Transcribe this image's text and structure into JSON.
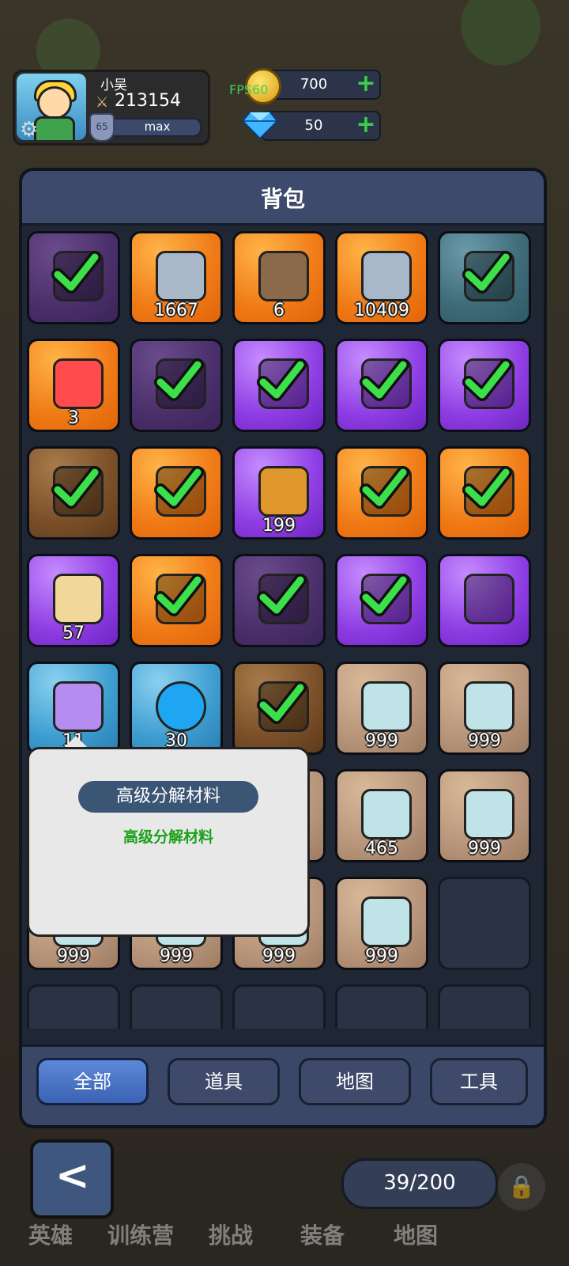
{
  "player": {
    "name": "小吴",
    "power": "213154",
    "level": "65",
    "level_status": "max"
  },
  "resources": {
    "gold": "700",
    "gems": "50",
    "fps_label": "FPS60"
  },
  "bag": {
    "title": "背包",
    "capacity": "39/200",
    "rows": [
      [
        {
          "rarity": "dpurple",
          "count": "",
          "checked": true,
          "icon": "helmet-icon"
        },
        {
          "rarity": "orange",
          "count": "1667",
          "checked": false,
          "icon": "rune-stone-icon"
        },
        {
          "rarity": "orange",
          "count": "6",
          "checked": false,
          "icon": "paw-icon"
        },
        {
          "rarity": "orange",
          "count": "10409",
          "checked": false,
          "icon": "rune-stone-icon"
        },
        {
          "rarity": "teal",
          "count": "",
          "checked": true,
          "icon": "sword-icon"
        }
      ],
      [
        {
          "rarity": "orange",
          "count": "3",
          "checked": false,
          "icon": "red-crystal-icon"
        },
        {
          "rarity": "dpurple",
          "count": "",
          "checked": true,
          "icon": "shield-icon"
        },
        {
          "rarity": "purple",
          "count": "",
          "checked": true,
          "icon": "scarf-icon"
        },
        {
          "rarity": "purple",
          "count": "",
          "checked": true,
          "icon": "ring-icon"
        },
        {
          "rarity": "purple",
          "count": "",
          "checked": true,
          "icon": "leaf-icon"
        }
      ],
      [
        {
          "rarity": "brown",
          "count": "",
          "checked": true,
          "icon": "helmet-icon"
        },
        {
          "rarity": "orange",
          "count": "",
          "checked": true,
          "icon": "gloves-icon"
        },
        {
          "rarity": "purple",
          "count": "199",
          "checked": false,
          "icon": "mask-icon"
        },
        {
          "rarity": "orange",
          "count": "",
          "checked": true,
          "icon": "bow-icon"
        },
        {
          "rarity": "orange",
          "count": "",
          "checked": true,
          "icon": "staff-icon"
        }
      ],
      [
        {
          "rarity": "purple",
          "count": "57",
          "checked": false,
          "icon": "map-icon"
        },
        {
          "rarity": "orange",
          "count": "",
          "checked": true,
          "icon": "gloves-icon"
        },
        {
          "rarity": "dpurple",
          "count": "",
          "checked": true,
          "icon": "armor-icon"
        },
        {
          "rarity": "purple",
          "count": "",
          "checked": true,
          "icon": "helmet-icon"
        },
        {
          "rarity": "purple",
          "count": "",
          "checked": false,
          "icon": "whip-icon"
        }
      ],
      [
        {
          "rarity": "blue",
          "count": "11",
          "checked": false,
          "icon": "purple-crystal-icon"
        },
        {
          "rarity": "blue",
          "count": "30",
          "checked": false,
          "icon": "blue-orb-icon"
        },
        {
          "rarity": "brown",
          "count": "",
          "checked": true,
          "icon": "belt-icon"
        },
        {
          "rarity": "tan",
          "count": "999",
          "checked": false,
          "icon": "stone-icon"
        },
        {
          "rarity": "tan",
          "count": "999",
          "checked": false,
          "icon": "stone-icon"
        }
      ],
      [
        {
          "rarity": "tan",
          "count": "",
          "checked": false,
          "icon": "stone-icon"
        },
        {
          "rarity": "tan",
          "count": "",
          "checked": false,
          "icon": "stone-icon"
        },
        {
          "rarity": "tan",
          "count": "",
          "checked": false,
          "icon": "stone-icon"
        },
        {
          "rarity": "tan",
          "count": "465",
          "checked": false,
          "icon": "stone-icon"
        },
        {
          "rarity": "tan",
          "count": "999",
          "checked": false,
          "icon": "stone-icon"
        }
      ],
      [
        {
          "rarity": "tan",
          "count": "999",
          "checked": false,
          "icon": "stone-icon"
        },
        {
          "rarity": "tan",
          "count": "999",
          "checked": false,
          "icon": "stone-icon"
        },
        {
          "rarity": "tan",
          "count": "999",
          "checked": false,
          "icon": "stone-icon"
        },
        {
          "rarity": "tan",
          "count": "999",
          "checked": false,
          "icon": "stone-icon"
        },
        {
          "rarity": "empty",
          "count": "",
          "checked": false,
          "icon": ""
        }
      ],
      [
        {
          "rarity": "empty",
          "count": "",
          "checked": false,
          "icon": ""
        },
        {
          "rarity": "empty",
          "count": "",
          "checked": false,
          "icon": ""
        },
        {
          "rarity": "empty",
          "count": "",
          "checked": false,
          "icon": ""
        },
        {
          "rarity": "empty",
          "count": "",
          "checked": false,
          "icon": ""
        },
        {
          "rarity": "empty",
          "count": "",
          "checked": false,
          "icon": ""
        }
      ]
    ]
  },
  "tooltip": {
    "title": "高级分解材料",
    "description": "高级分解材料"
  },
  "tabs": [
    {
      "label": "全部",
      "active": true
    },
    {
      "label": "道具",
      "active": false
    },
    {
      "label": "地图",
      "active": false
    },
    {
      "label": "工具",
      "active": false
    }
  ],
  "bottom_nav": [
    "英雄",
    "训练营",
    "挑战",
    "装备",
    "地图"
  ]
}
